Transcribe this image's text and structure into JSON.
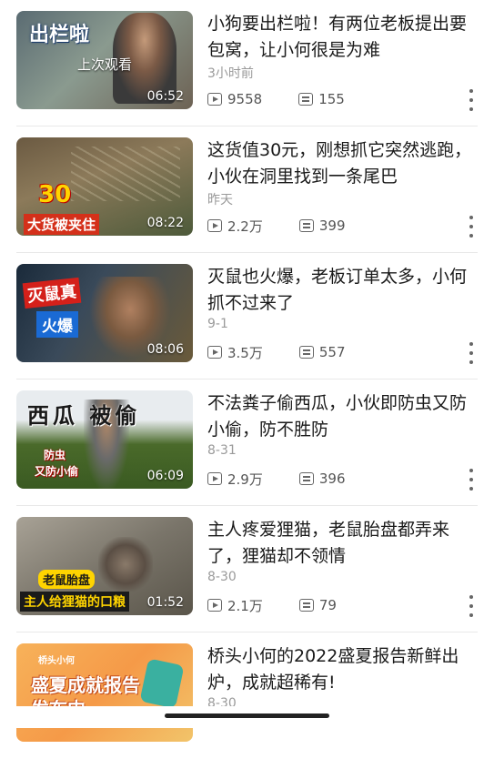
{
  "videos": [
    {
      "title": "小狗要出栏啦！有两位老板提出要包窝，让小何很是为难",
      "date": "3小时前",
      "views": "9558",
      "comments": "155",
      "duration": "06:52",
      "resume_label": "上次观看",
      "thumb_text": "出栏啦"
    },
    {
      "title": "这货值30元，刚想抓它突然逃跑，小伙在洞里找到一条尾巴",
      "date": "昨天",
      "views": "2.2万",
      "comments": "399",
      "duration": "08:22",
      "thumb_text": "30",
      "thumb_text2": "大货被夹住"
    },
    {
      "title": "灭鼠也火爆，老板订单太多，小何抓不过来了",
      "date": "9-1",
      "views": "3.5万",
      "comments": "557",
      "duration": "08:06",
      "thumb_text": "灭鼠真",
      "thumb_text2": "火爆"
    },
    {
      "title": "不法粪子偷西瓜，小伙即防虫又防小偷，防不胜防",
      "date": "8-31",
      "views": "2.9万",
      "comments": "396",
      "duration": "06:09",
      "thumb_text": "西瓜 被偷",
      "thumb_text2": "防虫",
      "thumb_text3": "又防小偷"
    },
    {
      "title": "主人疼爱狸猫，老鼠胎盘都弄来了，狸猫却不领情",
      "date": "8-30",
      "views": "2.1万",
      "comments": "79",
      "duration": "01:52",
      "thumb_text": "老鼠胎盘",
      "thumb_text2": "主人给狸猫的口粮"
    },
    {
      "title": "桥头小何的2022盛夏报告新鲜出炉，成就超稀有!",
      "date": "8-30",
      "thumb_text": "桥头小何",
      "thumb_text2": "盛夏成就报告",
      "thumb_text3": "发布中"
    }
  ]
}
